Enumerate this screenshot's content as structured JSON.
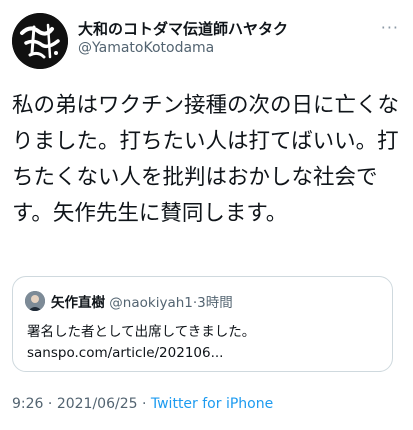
{
  "author": {
    "display_name": "大和のコトダマ伝道師ハヤタク",
    "handle": "@YamatoKotodama",
    "avatar_text": "大和の言魂"
  },
  "more_label": "···",
  "tweet": {
    "text": "私の弟はワクチン接種の次の日に亡くなりました。打ちたい人は打てばいい。打ちたくない人を批判はおかしな社会です。矢作先生に賛同します。"
  },
  "quoted": {
    "display_name": "矢作直樹",
    "handle": "@naokiyah1",
    "separator": "·",
    "time": "3時間",
    "line1": "署名した者として出席してきました。",
    "line2": "sanspo.com/article/202106..."
  },
  "footer": {
    "time": "9:26",
    "separator1": " · ",
    "date": "2021/06/25",
    "separator2": " · ",
    "source": "Twitter for iPhone"
  }
}
